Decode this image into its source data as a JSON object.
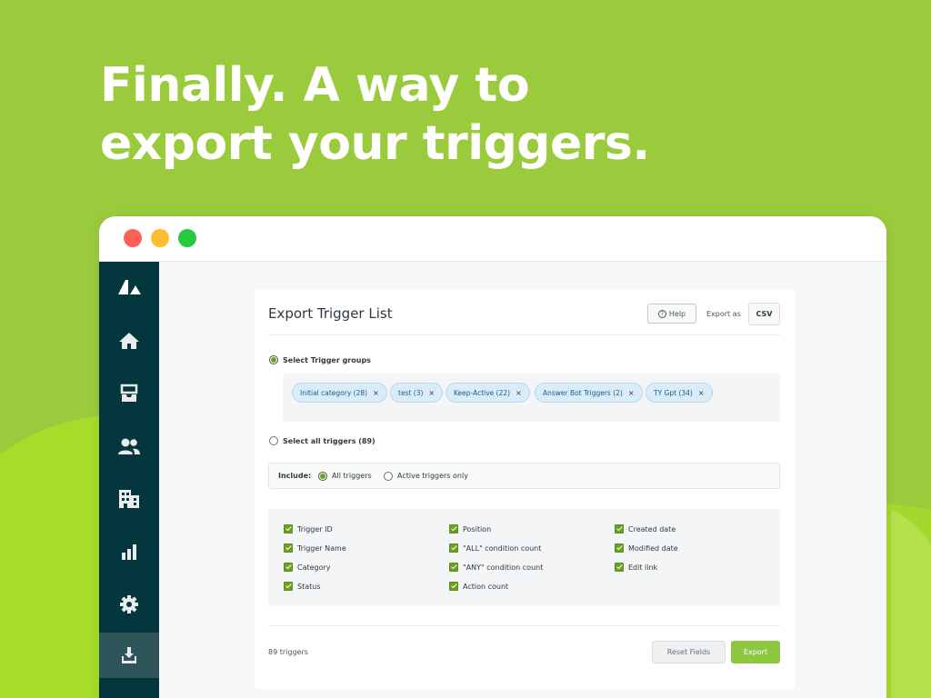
{
  "hero": {
    "line1": "Finally. A way to",
    "line2": "export your triggers."
  },
  "colors": {
    "background": "#9acb3c",
    "sidebar": "#03363d",
    "accent": "#8dc63f",
    "tag_bg": "#d9ecf8"
  },
  "sidebar": {
    "items": [
      {
        "icon": "zendesk-logo-icon",
        "active": false
      },
      {
        "icon": "home-icon",
        "active": false
      },
      {
        "icon": "inbox-icon",
        "active": false
      },
      {
        "icon": "users-icon",
        "active": false
      },
      {
        "icon": "building-icon",
        "active": false
      },
      {
        "icon": "bar-chart-icon",
        "active": false
      },
      {
        "icon": "gear-icon",
        "active": false
      },
      {
        "icon": "download-icon",
        "active": true
      }
    ]
  },
  "panel": {
    "title": "Export Trigger List",
    "help_label": "Help",
    "export_as_label": "Export as",
    "format_value": "CSV",
    "select_groups_label": "Select Trigger groups",
    "select_groups_selected": true,
    "groups": [
      {
        "label": "Initial category (28)",
        "remove": "×"
      },
      {
        "label": "test (3)",
        "remove": "×"
      },
      {
        "label": "Keep-Active (22)",
        "remove": "×"
      },
      {
        "label": "Answer Bot Triggers (2)",
        "remove": "×"
      },
      {
        "label": "TY Gpt (34)",
        "remove": "×"
      }
    ],
    "select_all_label": "Select all triggers (89)",
    "select_all_selected": false,
    "include": {
      "label": "Include:",
      "options": [
        {
          "label": "All triggers",
          "selected": true
        },
        {
          "label": "Active triggers only",
          "selected": false
        }
      ]
    },
    "fields": [
      {
        "label": "Trigger ID",
        "checked": true
      },
      {
        "label": "Trigger Name",
        "checked": true
      },
      {
        "label": "Category",
        "checked": true
      },
      {
        "label": "Status",
        "checked": true
      },
      {
        "label": "Position",
        "checked": true
      },
      {
        "label": "\"ALL\" condition count",
        "checked": true
      },
      {
        "label": "\"ANY\" condition count",
        "checked": true
      },
      {
        "label": "Action count",
        "checked": true
      },
      {
        "label": "Created date",
        "checked": true
      },
      {
        "label": "Modified date",
        "checked": true
      },
      {
        "label": "Edit link",
        "checked": true
      }
    ],
    "footer": {
      "count_label": "89 triggers",
      "reset_label": "Reset Fields",
      "export_label": "Export"
    }
  }
}
